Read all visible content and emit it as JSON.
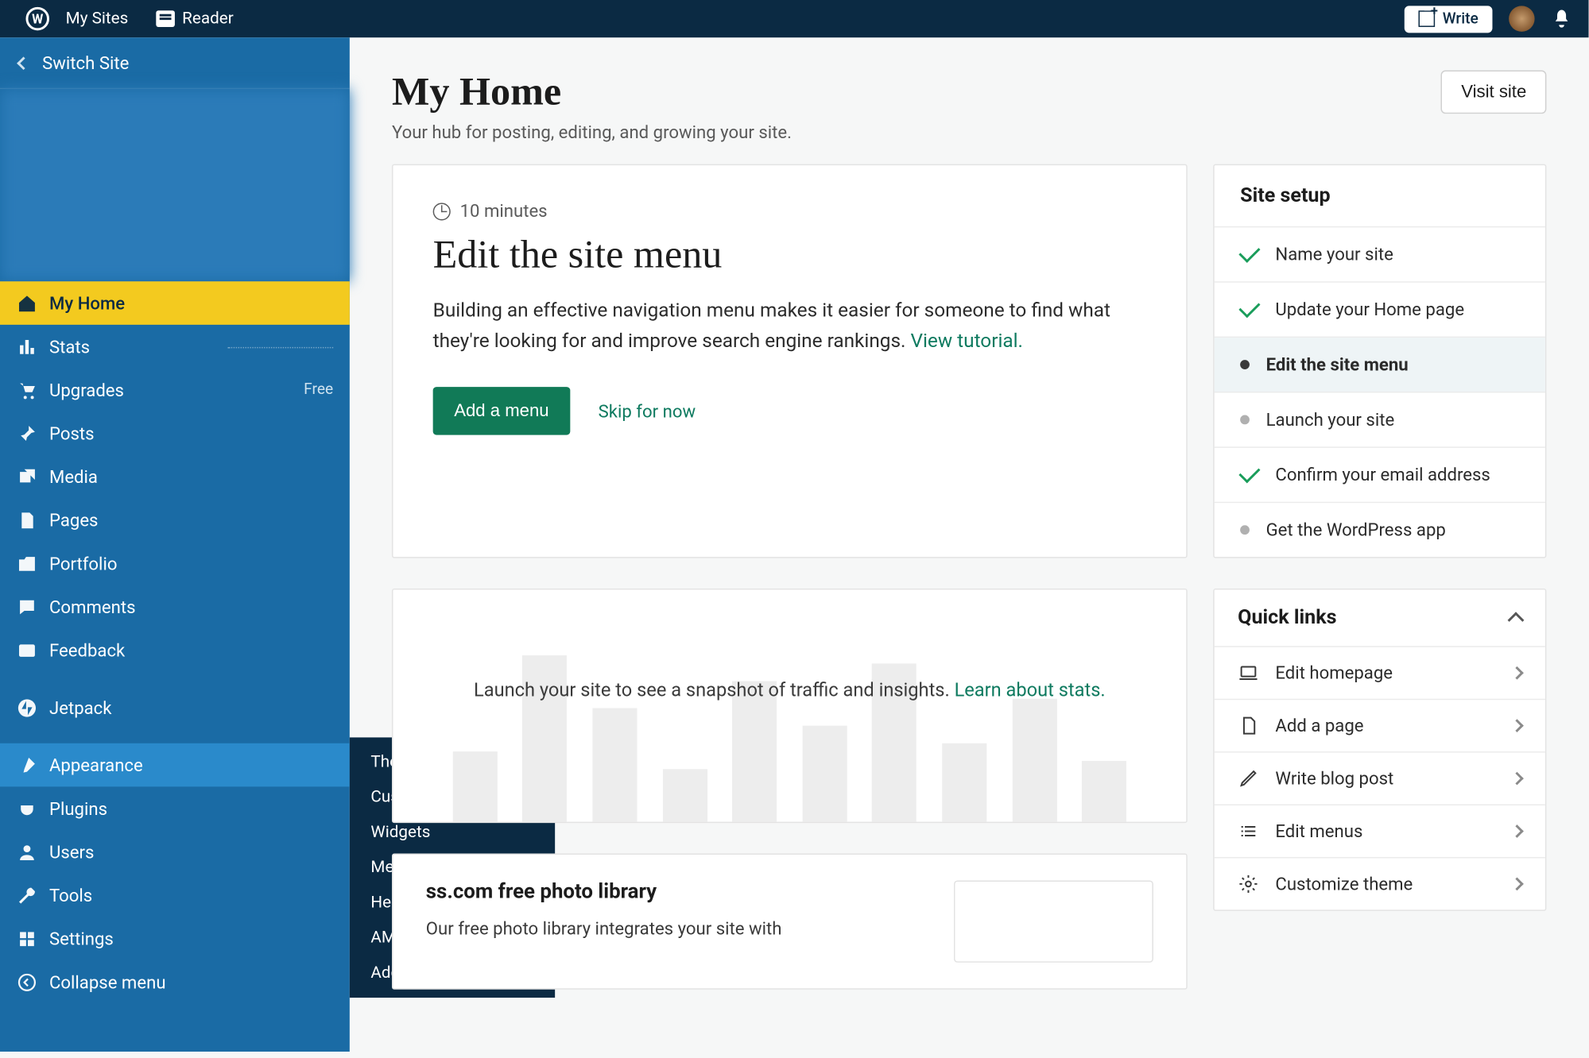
{
  "topbar": {
    "my_sites": "My Sites",
    "reader": "Reader",
    "write": "Write"
  },
  "sidebar": {
    "switch_site": "Switch Site",
    "items": [
      {
        "label": "My Home"
      },
      {
        "label": "Stats"
      },
      {
        "label": "Upgrades",
        "badge": "Free"
      },
      {
        "label": "Posts"
      },
      {
        "label": "Media"
      },
      {
        "label": "Pages"
      },
      {
        "label": "Portfolio"
      },
      {
        "label": "Comments"
      },
      {
        "label": "Feedback"
      },
      {
        "label": "Jetpack"
      },
      {
        "label": "Appearance"
      },
      {
        "label": "Plugins"
      },
      {
        "label": "Users"
      },
      {
        "label": "Tools"
      },
      {
        "label": "Settings"
      },
      {
        "label": "Collapse menu"
      }
    ]
  },
  "flyout": {
    "items": [
      "Themes",
      "Customize",
      "Widgets",
      "Menus",
      "Header",
      "AMP",
      "Additional CSS"
    ]
  },
  "page": {
    "title": "My Home",
    "subtitle": "Your hub for posting, editing, and growing your site.",
    "visit": "Visit site"
  },
  "hero": {
    "time": "10 minutes",
    "title": "Edit the site menu",
    "text": "Building an effective navigation menu makes it easier for someone to find what they're looking for and improve search engine rankings. ",
    "tutorial": "View tutorial.",
    "primary": "Add a menu",
    "skip": "Skip for now"
  },
  "setup": {
    "title": "Site setup",
    "items": [
      {
        "label": "Name your site",
        "state": "done"
      },
      {
        "label": "Update your Home page",
        "state": "done"
      },
      {
        "label": "Edit the site menu",
        "state": "current"
      },
      {
        "label": "Launch your site",
        "state": "todo"
      },
      {
        "label": "Confirm your email address",
        "state": "done"
      },
      {
        "label": "Get the WordPress app",
        "state": "todo"
      }
    ]
  },
  "stats_card": {
    "text1": "Launch your site to see a snapshot of traffic and insights. ",
    "link": "Learn about stats."
  },
  "quick_links": {
    "title": "Quick links",
    "items": [
      "Edit homepage",
      "Add a page",
      "Write blog post",
      "Edit menus",
      "Customize theme"
    ]
  },
  "photo": {
    "title": "ss.com free photo library",
    "text": "Our free photo library integrates your site with"
  }
}
